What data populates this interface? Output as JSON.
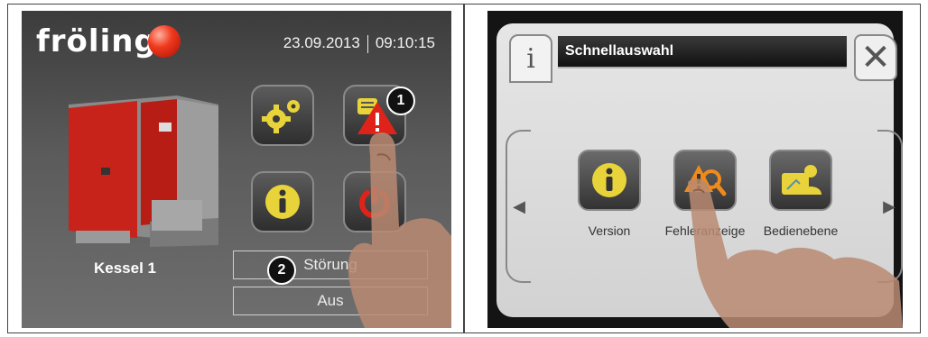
{
  "left_screen": {
    "logo_text": "fröling",
    "date": "23.09.2013",
    "time": "09:10:15",
    "boiler_label": "Kessel 1",
    "callout_1": "1",
    "callout_2": "2",
    "status_line_1": "Störung",
    "status_line_2": "Aus",
    "buttons": [
      "settings",
      "error-display",
      "info",
      "power"
    ]
  },
  "right_screen": {
    "title": "Schnellauswahl",
    "info_tab_glyph": "i",
    "close_glyph": "✕",
    "nav_left_glyph": "◀",
    "nav_right_glyph": "▶",
    "quick_buttons": [
      {
        "label": "Version",
        "icon": "info-icon"
      },
      {
        "label": "Fehleranzeige",
        "icon": "warning-search-icon"
      },
      {
        "label": "Bedienebene",
        "icon": "user-level-icon"
      }
    ]
  },
  "colors": {
    "brand_red": "#e2261a",
    "icon_yellow": "#f0dc3a",
    "warning_red": "#e0231a",
    "warning_orange": "#f08a1a"
  }
}
